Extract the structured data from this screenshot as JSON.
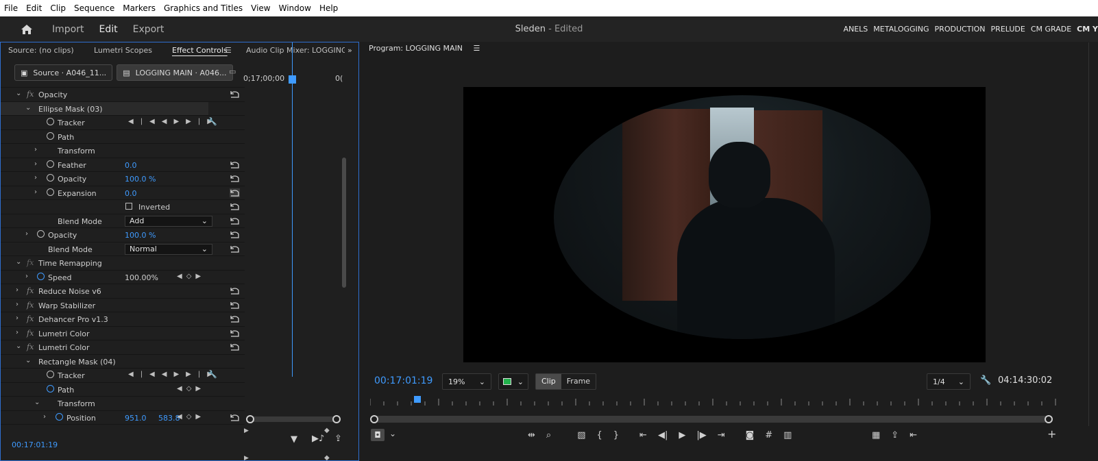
{
  "menu": [
    "File",
    "Edit",
    "Clip",
    "Sequence",
    "Markers",
    "Graphics and Titles",
    "View",
    "Window",
    "Help"
  ],
  "header": {
    "tabs": [
      "Import",
      "Edit",
      "Export"
    ],
    "active_tab": "Edit",
    "title": "Sleden",
    "title_suffix": " - Edited",
    "workspaces": [
      "ANELS",
      "METALOGGING",
      "PRODUCTION",
      "PRELUDE",
      "CM GRADE",
      "CM Y"
    ]
  },
  "left_panel": {
    "tabs": [
      "Source: (no clips)",
      "Lumetri Scopes",
      "Effect Controls",
      "Audio Clip Mixer: LOGGING M"
    ],
    "active_tab": "Effect Controls",
    "source_clip": "Source · A046_11...",
    "sequence_clip": "LOGGING MAIN · A046...",
    "ruler_start": "0;17;00;00",
    "ruler_end": "0(",
    "rows": [
      {
        "label": "Opacity",
        "fx": true
      },
      {
        "label": "Ellipse Mask (03)"
      },
      {
        "label": "Tracker"
      },
      {
        "label": "Path"
      },
      {
        "label": "Transform"
      },
      {
        "label": "Feather",
        "value": "0.0"
      },
      {
        "label": "Opacity",
        "value": "100.0 %"
      },
      {
        "label": "Expansion",
        "value": "0.0"
      },
      {
        "label": "Inverted"
      },
      {
        "label": "Blend Mode",
        "value": "Add"
      },
      {
        "label": "Opacity",
        "value": "100.0 %"
      },
      {
        "label": "Blend Mode",
        "value": "Normal"
      },
      {
        "label": "Time Remapping",
        "fx": true
      },
      {
        "label": "Speed",
        "value": "100.00%"
      },
      {
        "label": "Reduce Noise v6",
        "fx": true
      },
      {
        "label": "Warp Stabilizer",
        "fx": true
      },
      {
        "label": "Dehancer Pro v1.3",
        "fx": true
      },
      {
        "label": "Lumetri Color",
        "fx": true
      },
      {
        "label": "Lumetri Color",
        "fx": true
      },
      {
        "label": "Rectangle Mask (04)"
      },
      {
        "label": "Tracker"
      },
      {
        "label": "Path"
      },
      {
        "label": "Transform"
      },
      {
        "label": "Position",
        "value": "951.0",
        "value2": "583.8"
      }
    ],
    "footer_timecode": "00:17:01:19"
  },
  "program": {
    "title": "Program: LOGGING MAIN",
    "current_timecode": "00:17:01:19",
    "zoom": "19%",
    "clip_label": "Clip",
    "frame_label": "Frame",
    "resolution": "1/4",
    "duration": "04:14:30:02"
  }
}
